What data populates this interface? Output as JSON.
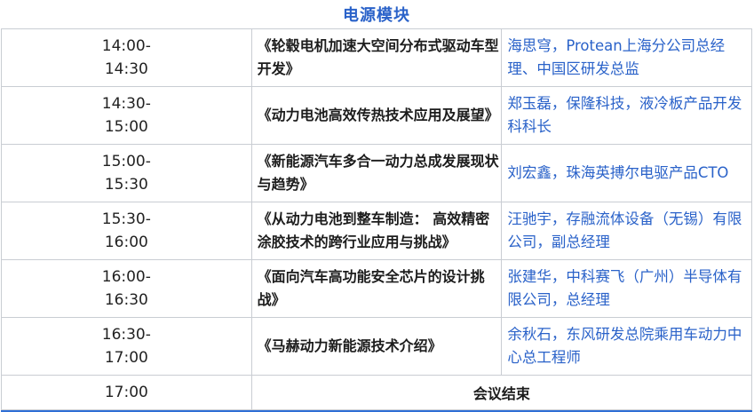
{
  "header": {
    "title": "电源模块"
  },
  "sessions": [
    {
      "time_start": "14:00-",
      "time_end": "14:30",
      "topic": "《轮毂电机加速大空间分布式驱动车型开发》",
      "speaker": "海思穹，Protean上海分公司总经理、中国区研发总监"
    },
    {
      "time_start": "14:30-",
      "time_end": "15:00",
      "topic": "《动力电池高效传热技术应用及展望》",
      "speaker": "郑玉磊，保隆科技，液冷板产品开发科科长"
    },
    {
      "time_start": "15:00-",
      "time_end": "15:30",
      "topic": "《新能源汽车多合一动力总成发展现状与趋势》",
      "speaker": "刘宏鑫，珠海英搏尔电驱产品CTO"
    },
    {
      "time_start": "15:30-",
      "time_end": "16:00",
      "topic": "《从动力电池到整车制造： 高效精密涂胶技术的跨行业应用与挑战》",
      "speaker": "汪驰宇，存融流体设备（无锡）有限公司，副总经理"
    },
    {
      "time_start": "16:00-",
      "time_end": "16:30",
      "topic": "《面向汽车高功能安全芯片的设计挑战》",
      "speaker": "张建华，中科赛飞（广州）半导体有限公司，总经理"
    },
    {
      "time_start": "16:30-",
      "time_end": "17:00",
      "topic": "《马赫动力新能源技术介绍》",
      "speaker": "余秋石，东风研发总院乘用车动力中心总工程师"
    }
  ],
  "closing": {
    "time": "17:00",
    "label": "会议结束"
  },
  "colors": {
    "accent_blue": "#2a62c9",
    "border_gray": "#c9cdd3",
    "bottom_bar": "#2f6fd6"
  }
}
